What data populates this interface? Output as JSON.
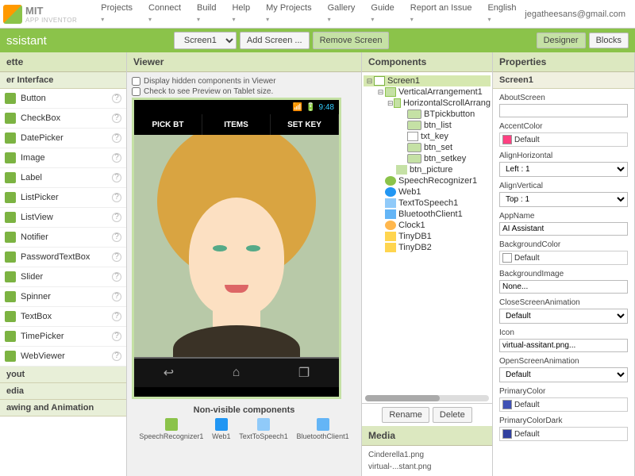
{
  "topmenu": [
    "Projects",
    "Connect",
    "Build",
    "Help",
    "My Projects",
    "Gallery",
    "Guide",
    "Report an Issue",
    "English"
  ],
  "user_email": "jegatheesans@gmail.com",
  "logo": {
    "mit": "MIT",
    "sub": "APP INVENTOR"
  },
  "greenbar": {
    "title": "ssistant",
    "screen_sel": "Screen1",
    "add": "Add Screen ...",
    "remove": "Remove Screen",
    "designer": "Designer",
    "blocks": "Blocks"
  },
  "palette": {
    "head": "ette",
    "sub": "er Interface",
    "items": [
      "Button",
      "CheckBox",
      "DatePicker",
      "Image",
      "Label",
      "ListPicker",
      "ListView",
      "Notifier",
      "PasswordTextBox",
      "Slider",
      "Spinner",
      "TextBox",
      "TimePicker",
      "WebViewer"
    ],
    "cats": [
      "yout",
      "edia",
      "awing and Animation"
    ]
  },
  "viewer": {
    "head": "Viewer",
    "hiddencb": "Display hidden components in Viewer",
    "tabletcb": "Check to see Preview on Tablet size.",
    "time": "9:48",
    "menubtns": [
      "PICK BT",
      "ITEMS",
      "SET KEY"
    ],
    "nv_title": "Non-visible components",
    "nv_items": [
      "SpeechRecognizer1",
      "Web1",
      "TextToSpeech1",
      "BluetoothClient1"
    ]
  },
  "components": {
    "head": "Components",
    "tree": [
      {
        "d": 0,
        "t": "screen",
        "label": "Screen1",
        "exp": true,
        "sel": true
      },
      {
        "d": 1,
        "t": "vert",
        "label": "VerticalArrangement1",
        "exp": true
      },
      {
        "d": 2,
        "t": "horiz",
        "label": "HorizontalScrollArrang",
        "exp": true
      },
      {
        "d": 3,
        "t": "btn",
        "label": "BTpickbutton"
      },
      {
        "d": 3,
        "t": "btn",
        "label": "btn_list"
      },
      {
        "d": 3,
        "t": "txt",
        "label": "txt_key"
      },
      {
        "d": 3,
        "t": "btn",
        "label": "btn_set"
      },
      {
        "d": 3,
        "t": "btn",
        "label": "btn_setkey"
      },
      {
        "d": 2,
        "t": "img",
        "label": "btn_picture"
      },
      {
        "d": 1,
        "t": "sr",
        "label": "SpeechRecognizer1"
      },
      {
        "d": 1,
        "t": "web",
        "label": "Web1"
      },
      {
        "d": 1,
        "t": "tts",
        "label": "TextToSpeech1"
      },
      {
        "d": 1,
        "t": "bt",
        "label": "BluetoothClient1"
      },
      {
        "d": 1,
        "t": "clk",
        "label": "Clock1"
      },
      {
        "d": 1,
        "t": "db",
        "label": "TinyDB1"
      },
      {
        "d": 1,
        "t": "db",
        "label": "TinyDB2"
      }
    ],
    "rename": "Rename",
    "delete": "Delete",
    "media_head": "Media",
    "media": [
      "Cinderella1.png",
      "virtual-...stant.png"
    ]
  },
  "props": {
    "head": "Properties",
    "target": "Screen1",
    "list": [
      {
        "label": "AboutScreen",
        "type": "text",
        "value": ""
      },
      {
        "label": "AccentColor",
        "type": "color",
        "value": "Default",
        "hex": "#ff4081"
      },
      {
        "label": "AlignHorizontal",
        "type": "select",
        "value": "Left : 1"
      },
      {
        "label": "AlignVertical",
        "type": "select",
        "value": "Top : 1"
      },
      {
        "label": "AppName",
        "type": "text",
        "value": "AI Assistant"
      },
      {
        "label": "BackgroundColor",
        "type": "color",
        "value": "Default",
        "hex": "#ffffff"
      },
      {
        "label": "BackgroundImage",
        "type": "text",
        "value": "None..."
      },
      {
        "label": "CloseScreenAnimation",
        "type": "select",
        "value": "Default"
      },
      {
        "label": "Icon",
        "type": "text",
        "value": "virtual-assitant.png..."
      },
      {
        "label": "OpenScreenAnimation",
        "type": "select",
        "value": "Default"
      },
      {
        "label": "PrimaryColor",
        "type": "color",
        "value": "Default",
        "hex": "#3f51b5"
      },
      {
        "label": "PrimaryColorDark",
        "type": "color",
        "value": "Default",
        "hex": "#303f9f"
      }
    ]
  }
}
